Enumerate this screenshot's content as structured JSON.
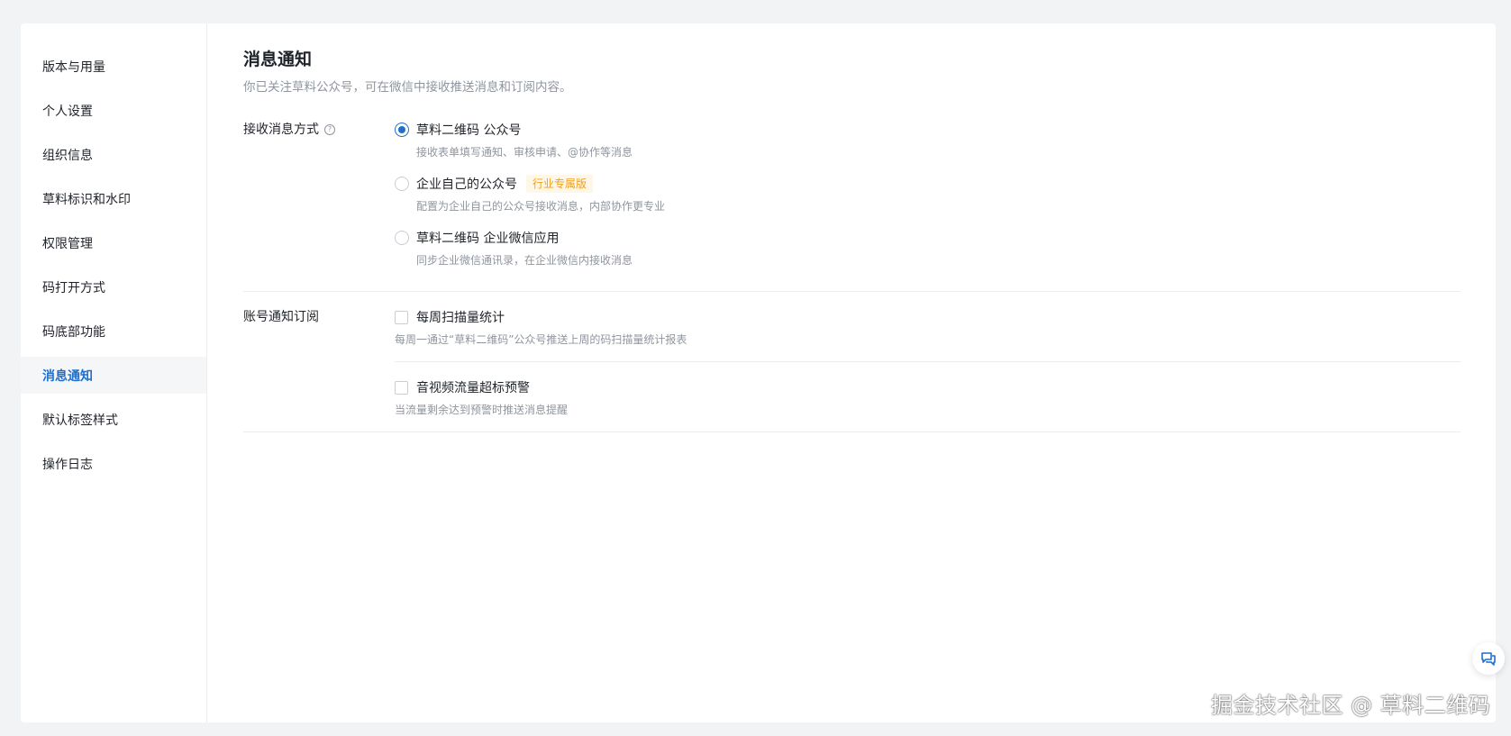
{
  "sidebar": {
    "items": [
      {
        "label": "版本与用量"
      },
      {
        "label": "个人设置"
      },
      {
        "label": "组织信息"
      },
      {
        "label": "草料标识和水印"
      },
      {
        "label": "权限管理"
      },
      {
        "label": "码打开方式"
      },
      {
        "label": "码底部功能"
      },
      {
        "label": "消息通知",
        "active": true
      },
      {
        "label": "默认标签样式"
      },
      {
        "label": "操作日志"
      }
    ]
  },
  "main": {
    "title": "消息通知",
    "description": "你已关注草料公众号，可在微信中接收推送消息和订阅内容。",
    "receive": {
      "label": "接收消息方式",
      "help_icon_glyph": "?",
      "options": [
        {
          "label": "草料二维码 公众号",
          "desc": "接收表单填写通知、审核申请、@协作等消息",
          "checked": true
        },
        {
          "label": "企业自己的公众号",
          "badge": "行业专属版",
          "desc": "配置为企业自己的公众号接收消息，内部协作更专业",
          "checked": false
        },
        {
          "label": "草料二维码 企业微信应用",
          "desc": "同步企业微信通讯录，在企业微信内接收消息",
          "checked": false
        }
      ]
    },
    "subscribe": {
      "label": "账号通知订阅",
      "items": [
        {
          "label": "每周扫描量统计",
          "desc": "每周一通过“草料二维码”公众号推送上周的码扫描量统计报表",
          "checked": false
        },
        {
          "label": "音视频流量超标预警",
          "desc": "当流量剩余达到预警时推送消息提醒",
          "checked": false
        }
      ]
    }
  },
  "watermark": "掘金技术社区 @ 草料二维码",
  "colors": {
    "accent": "#1e6fce",
    "badge_text": "#f0a020",
    "badge_bg": "#fef6e6",
    "muted_text": "#8f959e"
  },
  "icons": {
    "float_button": "chat-bubble-icon"
  }
}
